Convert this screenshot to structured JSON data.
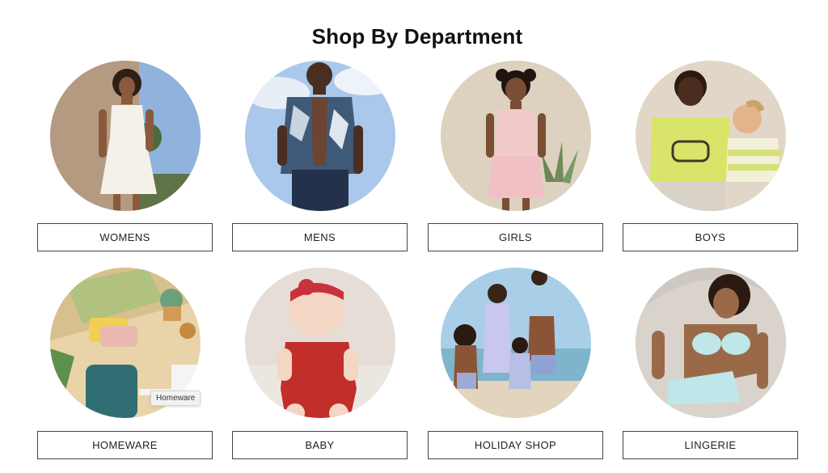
{
  "page": {
    "title": "Shop By Department"
  },
  "departments": [
    {
      "label": "WOMENS"
    },
    {
      "label": "MENS"
    },
    {
      "label": "GIRLS"
    },
    {
      "label": "BOYS"
    },
    {
      "label": "HOMEWARE"
    },
    {
      "label": "BABY"
    },
    {
      "label": "HOLIDAY SHOP"
    },
    {
      "label": "LINGERIE"
    }
  ],
  "tooltip": {
    "text": "Homeware"
  }
}
